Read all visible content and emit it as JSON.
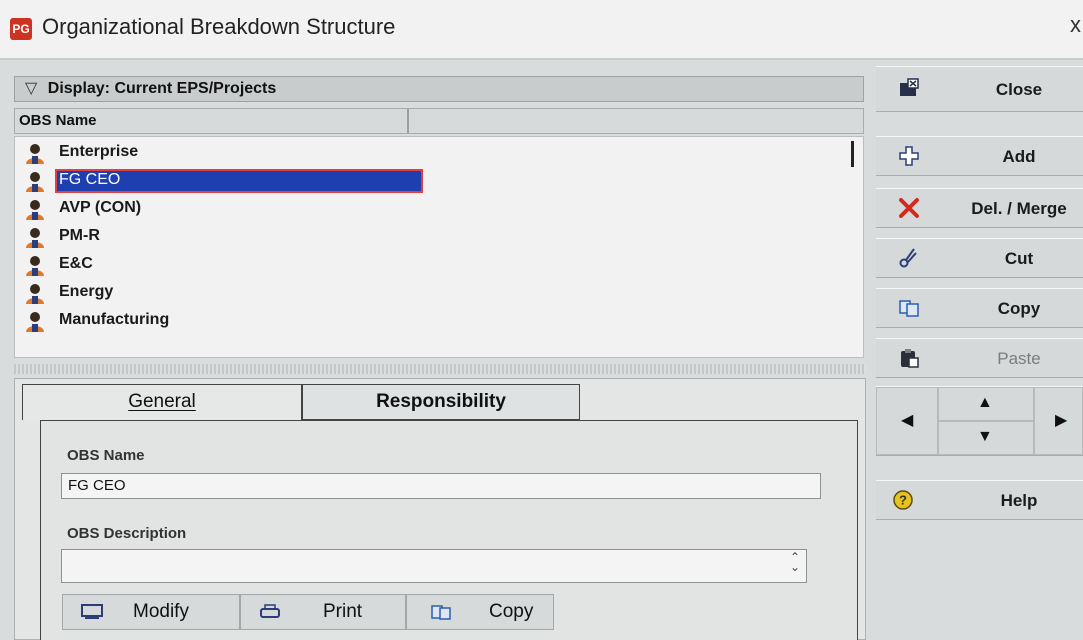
{
  "window": {
    "title": "Organizational Breakdown Structure",
    "app_icon_text": "PG",
    "close_glyph": "x"
  },
  "list": {
    "display_label": "Display: Current EPS/Projects",
    "column_header": "OBS Name",
    "items": [
      {
        "label": "Enterprise",
        "selected": false
      },
      {
        "label": "FG CEO",
        "selected": true
      },
      {
        "label": "AVP (CON)",
        "selected": false
      },
      {
        "label": "PM-R",
        "selected": false
      },
      {
        "label": "E&C",
        "selected": false
      },
      {
        "label": "Energy",
        "selected": false
      },
      {
        "label": "Manufacturing",
        "selected": false
      }
    ]
  },
  "tabs": {
    "general": "General",
    "responsibility": "Responsibility"
  },
  "form": {
    "obs_name_label": "OBS Name",
    "obs_name_value": "FG CEO",
    "obs_desc_label": "OBS Description",
    "obs_desc_value": ""
  },
  "bottom_buttons": {
    "modify": "Modify",
    "print": "Print",
    "copy": "Copy"
  },
  "toolbar": {
    "close": "Close",
    "add": "Add",
    "del_merge": "Del. / Merge",
    "cut": "Cut",
    "copy": "Copy",
    "paste": "Paste",
    "help": "Help"
  },
  "icons": [
    "close-icon",
    "add-icon",
    "delete-icon",
    "cut-icon",
    "copy-icon",
    "paste-icon",
    "help-icon",
    "person-icon",
    "modify-icon",
    "print-icon"
  ],
  "colors": {
    "selection": "#1d3fb0",
    "selection_border": "#e04040",
    "delete_red": "#d42a1e",
    "help_yellow": "#e8c21c"
  }
}
